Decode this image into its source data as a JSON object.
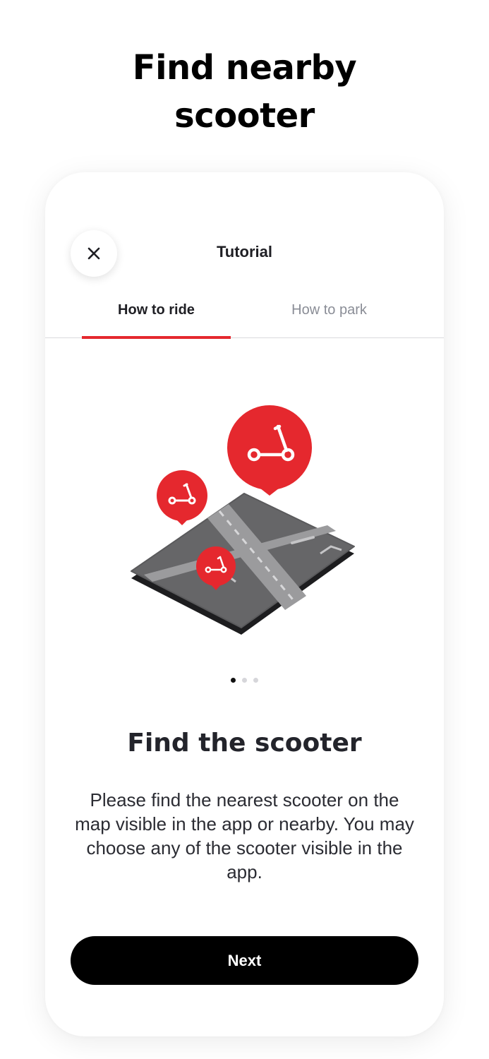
{
  "headline": {
    "line1": "Find nearby",
    "line2": "scooter"
  },
  "card": {
    "title": "Tutorial",
    "close_icon": "close-icon",
    "tabs": [
      {
        "label": "How to ride",
        "active": true
      },
      {
        "label": "How to park",
        "active": false
      }
    ],
    "illustration": "map-with-scooter-pins",
    "pagination": {
      "current": 1,
      "total": 3
    },
    "section_title": "Find the scooter",
    "description": "Please find the nearest scooter on the map visible in the app or nearby. You may choose any of the scooter visible in the app.",
    "next_label": "Next"
  },
  "colors": {
    "accent": "#e5282e",
    "button": "#000000",
    "text": "#1f1f24",
    "inactive_tab": "#8a8d96"
  }
}
